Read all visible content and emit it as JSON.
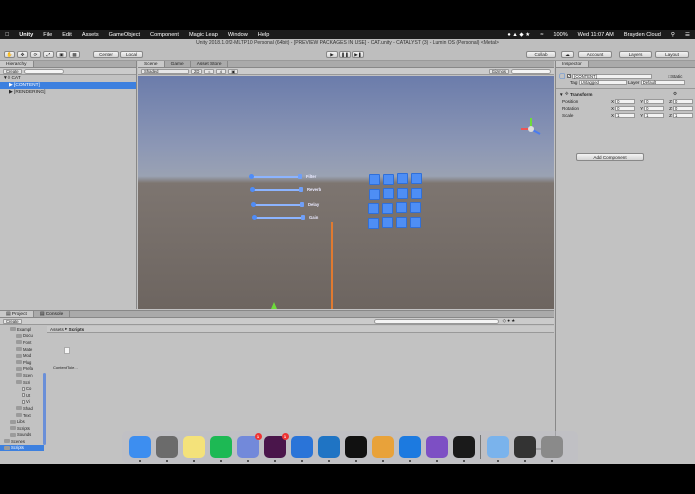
{
  "menubar": {
    "apple": "",
    "app": "Unity",
    "items": [
      "File",
      "Edit",
      "Assets",
      "GameObject",
      "Component",
      "Magic Leap",
      "Window",
      "Help"
    ],
    "battery": "100%",
    "clock": "Wed 11:07 AM",
    "user": "Brayden Cloud"
  },
  "window": {
    "title": "Unity 2018.1.0f2-MLTP10 Personal (64bit) - [PREVIEW PACKAGES IN USE] - CAT.unity - CATALYST (3) - Lumin OS (Personal) <Metal>"
  },
  "toolbar": {
    "center": "Center",
    "local": "Local",
    "collab": "Collab",
    "account": "Account",
    "layers": "Layers",
    "layout": "Layout"
  },
  "hierarchy": {
    "tab": "Hierarchy",
    "create": "Create",
    "search_placeholder": "All",
    "scene": "CAT",
    "items": [
      "[CONTENT]",
      "[RENDERING]"
    ]
  },
  "scene_tabs": [
    "Scene",
    "Game",
    "Asset Store"
  ],
  "scene_bar": {
    "shading": "Shaded",
    "mode": "2D",
    "gizmos": "Gizmos",
    "search_placeholder": "All"
  },
  "scene": {
    "sliders": [
      "Filter",
      "Reverb",
      "Delay",
      "Gain"
    ],
    "grid_rows": 4,
    "grid_cols": 4
  },
  "inspector": {
    "tab": "Inspector",
    "object": "[CONTENT]",
    "static": "Static",
    "tag_label": "Tag",
    "tag": "Untagged",
    "layer_label": "Layer",
    "layer": "Default",
    "transform": "Transform",
    "rows": [
      {
        "label": "Position",
        "x": "0",
        "y": "0",
        "z": "0"
      },
      {
        "label": "Rotation",
        "x": "0",
        "y": "0",
        "z": "0"
      },
      {
        "label": "Scale",
        "x": "1",
        "y": "1",
        "z": "1"
      }
    ],
    "add_component": "Add Component"
  },
  "project": {
    "tabs": [
      "Project",
      "Console"
    ],
    "create": "Create",
    "breadcrumb": [
      "Assets",
      "Scripts"
    ],
    "tree": [
      {
        "label": "Exampl",
        "depth": 1
      },
      {
        "label": "Docu",
        "depth": 2
      },
      {
        "label": "Font",
        "depth": 2
      },
      {
        "label": "Mate",
        "depth": 2
      },
      {
        "label": "Mod",
        "depth": 2
      },
      {
        "label": "Plug",
        "depth": 2
      },
      {
        "label": "Prefa",
        "depth": 2
      },
      {
        "label": "Scen",
        "depth": 2
      },
      {
        "label": "Scri",
        "depth": 2
      },
      {
        "label": "Co",
        "depth": 3
      },
      {
        "label": "Ut",
        "depth": 3
      },
      {
        "label": "Vi",
        "depth": 3
      },
      {
        "label": "Shad",
        "depth": 2
      },
      {
        "label": "Text",
        "depth": 2
      },
      {
        "label": "Libs",
        "depth": 1
      },
      {
        "label": "Scripts",
        "depth": 1
      },
      {
        "label": "Sounds",
        "depth": 1
      },
      {
        "label": "Scenes",
        "depth": 0
      },
      {
        "label": "Scripts",
        "depth": 0
      }
    ],
    "file": "ContentTole..."
  },
  "dock": [
    {
      "name": "finder",
      "color": "#3d8ef0"
    },
    {
      "name": "launchpad",
      "color": "#6b6b6b"
    },
    {
      "name": "notes",
      "color": "#f4e27a"
    },
    {
      "name": "spotify",
      "color": "#1db954"
    },
    {
      "name": "discord",
      "color": "#7289da",
      "badge": "1"
    },
    {
      "name": "slack",
      "color": "#4a154b",
      "badge": "1"
    },
    {
      "name": "xcode",
      "color": "#2a74d8"
    },
    {
      "name": "visual-studio-code",
      "color": "#1f74c4"
    },
    {
      "name": "terminal",
      "color": "#111111"
    },
    {
      "name": "chrome",
      "color": "#e8a23a"
    },
    {
      "name": "testflight",
      "color": "#1c7ae0"
    },
    {
      "name": "visual-studio",
      "color": "#7d4fc4"
    },
    {
      "name": "unity",
      "color": "#1a1a1a"
    },
    {
      "name": "documents",
      "color": "#7ab3ec"
    },
    {
      "name": "desktop",
      "color": "#333333"
    },
    {
      "name": "trash",
      "color": "#8a8a8a"
    }
  ]
}
